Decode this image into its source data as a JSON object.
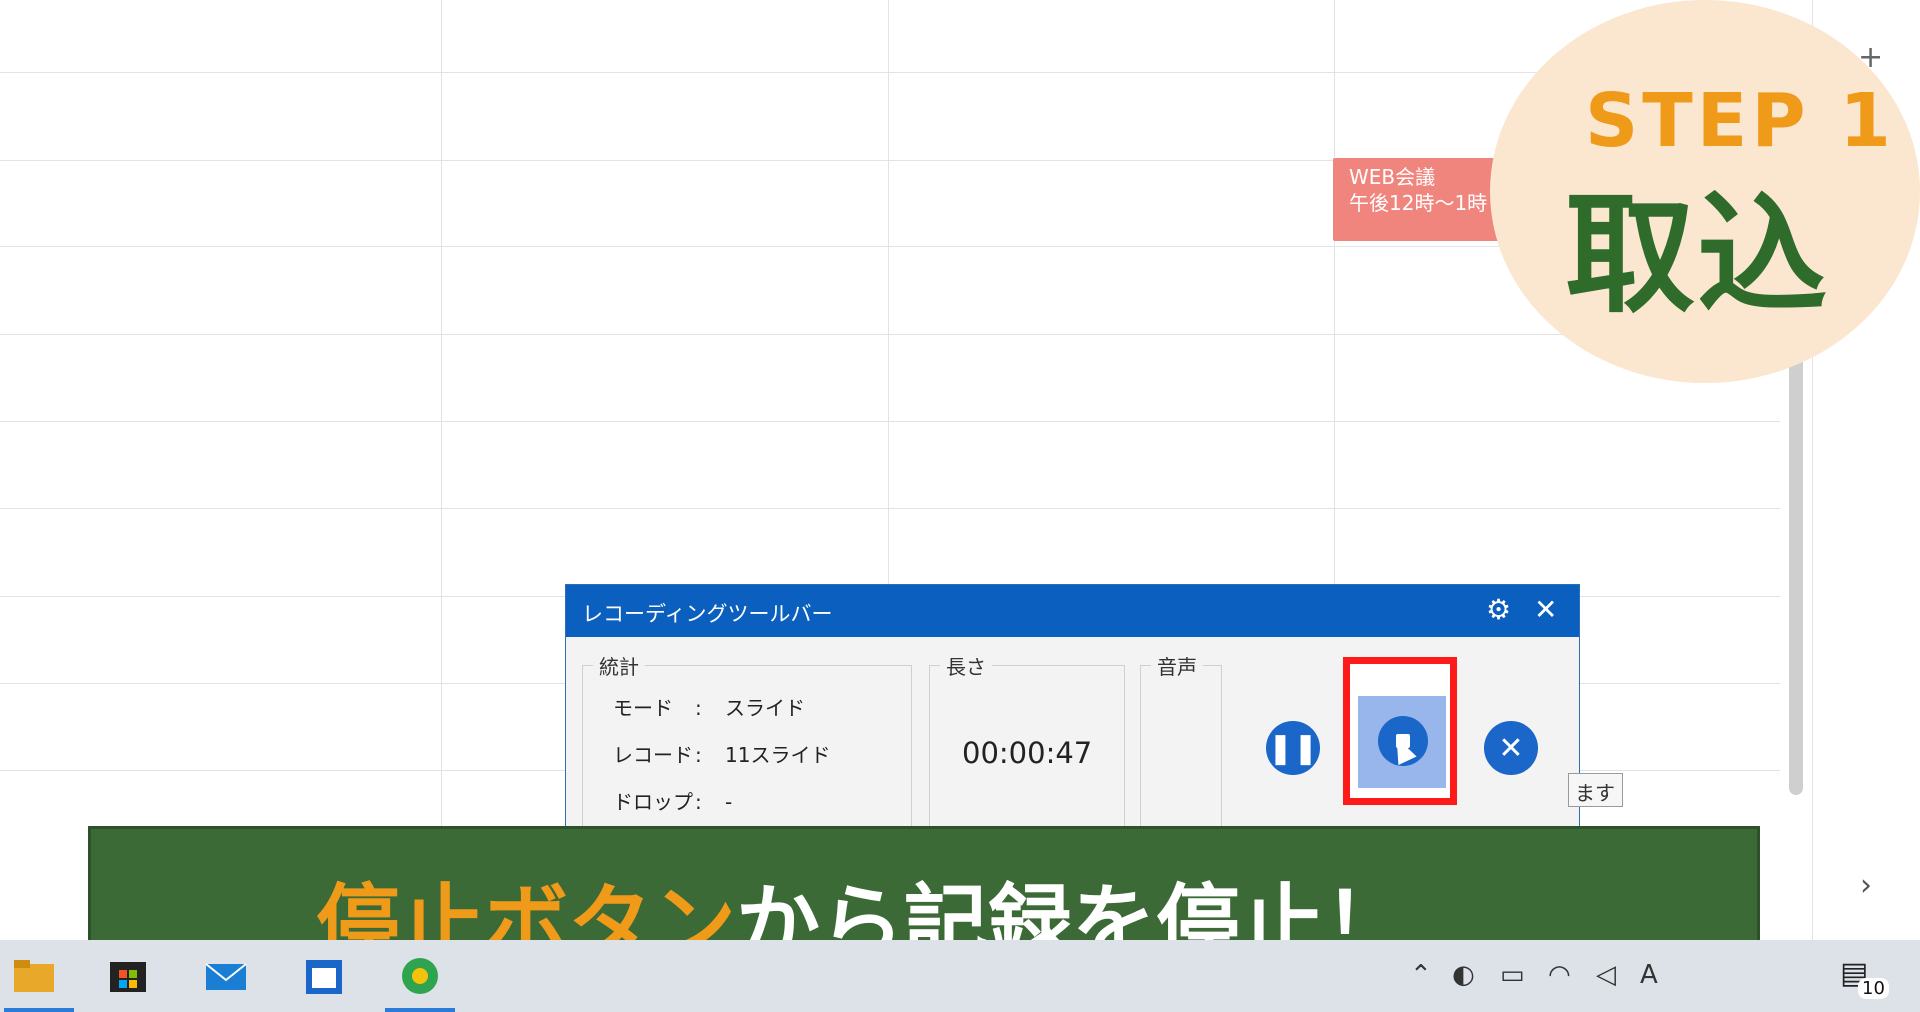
{
  "calendar_event": {
    "title": "WEB会議",
    "time": "午後12時〜1時"
  },
  "badge": {
    "step": "STEP 1",
    "label": "取込"
  },
  "recording_toolbar": {
    "title": "レコーディングツールバー",
    "stats": {
      "legend": "統計",
      "rows": [
        {
          "key": "モード",
          "sep": ":",
          "value": "スライド"
        },
        {
          "key": "レコード",
          "sep": ":",
          "value": "11スライド"
        },
        {
          "key": "ドロップ",
          "sep": ":",
          "value": "-"
        }
      ]
    },
    "length": {
      "legend": "長さ",
      "value": "00:00:47"
    },
    "audio": {
      "legend": "音声"
    },
    "tooltip_fragment": "ます"
  },
  "caption": {
    "highlight": "停止ボタン",
    "rest": "から記録を停止！"
  },
  "taskbar": {
    "notification_count": "10"
  },
  "colors": {
    "toolbar_title": "#0a5fbf",
    "stop_highlight": "#ff1a1a",
    "banner_bg": "#3b6a36",
    "highlight_text": "#f09a1a"
  }
}
